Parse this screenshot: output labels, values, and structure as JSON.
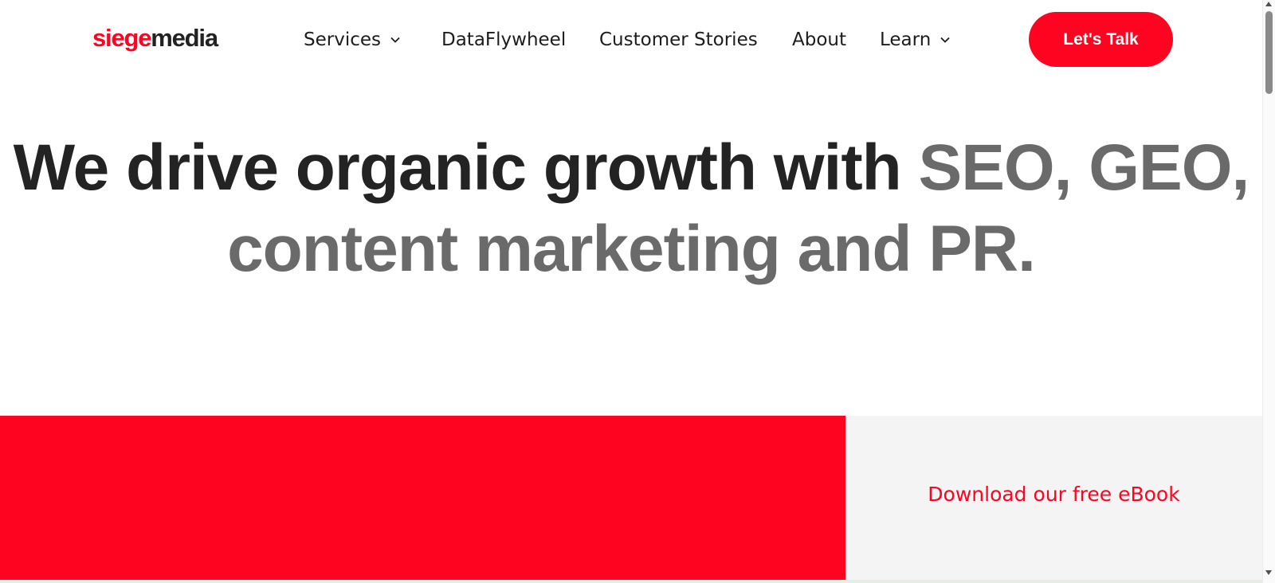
{
  "header": {
    "logo": {
      "part1": "siege",
      "part2": "media"
    },
    "nav": [
      {
        "label": "Services",
        "has_dropdown": true
      },
      {
        "label": "DataFlywheel",
        "has_dropdown": false
      },
      {
        "label": "Customer Stories",
        "has_dropdown": false
      },
      {
        "label": "About",
        "has_dropdown": false
      },
      {
        "label": "Learn",
        "has_dropdown": true
      }
    ],
    "cta_label": "Let's Talk"
  },
  "hero": {
    "headline_dark": "We drive organic growth with ",
    "headline_gray": "SEO, GEO, content marketing and PR."
  },
  "promo": {
    "link_label": "Download our free eBook"
  },
  "colors": {
    "brand_red": "#ff0420",
    "text_dark": "#232323",
    "text_gray": "#6a6a6a",
    "panel_gray": "#f4f4f4"
  },
  "icons": {
    "dropdown": "chevron-down-icon"
  }
}
